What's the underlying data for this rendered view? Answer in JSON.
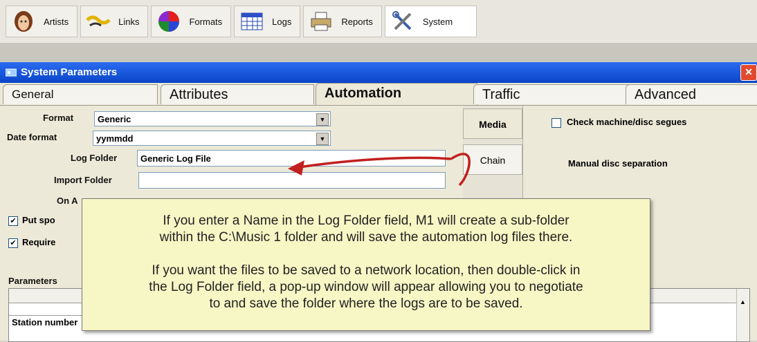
{
  "toolbar": {
    "items": [
      {
        "label": "Artists",
        "icon": "artist-face-icon"
      },
      {
        "label": "Links",
        "icon": "links-icon"
      },
      {
        "label": "Formats",
        "icon": "formats-pie-icon"
      },
      {
        "label": "Logs",
        "icon": "logs-grid-icon"
      },
      {
        "label": "Reports",
        "icon": "printer-icon"
      },
      {
        "label": "System",
        "icon": "tools-icon"
      }
    ]
  },
  "window": {
    "title": "System Parameters",
    "close_symbol": "✕"
  },
  "tabs": [
    {
      "label": "General"
    },
    {
      "label": "Attributes"
    },
    {
      "label": "Automation"
    },
    {
      "label": "Traffic"
    },
    {
      "label": "Advanced"
    }
  ],
  "form": {
    "format_label": "Format",
    "format_value": "Generic",
    "date_format_label": "Date format",
    "date_format_value": "yymmdd",
    "log_folder_label": "Log Folder",
    "log_folder_value": "Generic Log File",
    "import_folder_label": "Import Folder",
    "import_folder_value": "",
    "on_air_label": "On A",
    "put_spots_label": "Put spo",
    "require_label": "Require",
    "parameters_label": "Parameters",
    "station_number_label": "Station number"
  },
  "right_panel": {
    "media_tab": "Media",
    "chain_tab": "Chain",
    "check_segues_label": "Check machine/disc segues",
    "manual_disc_label": "Manual disc separation"
  },
  "callout": {
    "para1_line1": "If you enter a Name in the Log Folder field, M1 will create a sub-folder",
    "para1_line2": "within the C:\\Music 1 folder and will save the automation log files there.",
    "para2_line1": "If you want the files to be saved to a network location, then double-click in",
    "para2_line2": "the Log Folder field, a pop-up window will appear allowing you to negotiate",
    "para2_line3": "to and save the folder where the logs are to be saved."
  },
  "colors": {
    "titlebar": "#0a45c9",
    "callout_bg": "#f7f6c5",
    "arrow": "#c21f1f"
  }
}
